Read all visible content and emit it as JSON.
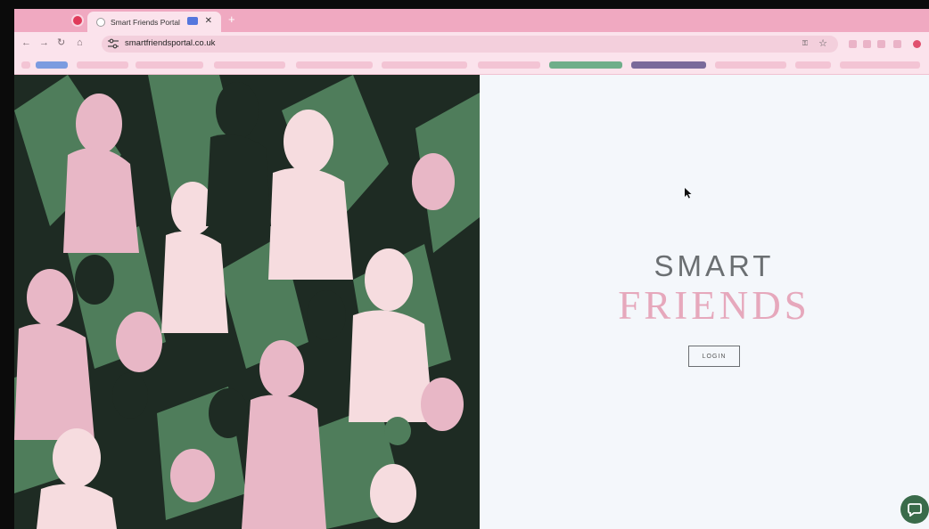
{
  "browser": {
    "tabs": [
      {
        "title": "",
        "active": false
      },
      {
        "title": "Smart Friends Portal",
        "active": true
      }
    ],
    "address": {
      "url": "smartfriendsportal.co.uk"
    },
    "colors": {
      "tabstrip": "#f0a9c1",
      "toolbar": "#fbe3ec",
      "omnibox": "#f3cfdc"
    },
    "icons": [
      "back-icon",
      "forward-icon",
      "reload-icon",
      "home-icon",
      "site-settings-icon",
      "password-key-icon",
      "bookmark-star-icon",
      "recording-icon",
      "close-icon",
      "new-tab-icon"
    ]
  },
  "page": {
    "brand": {
      "line1": "SMART",
      "line2": "FRIENDS"
    },
    "login_label": "LOGIN",
    "colors": {
      "brand_grey": "#6b6f72",
      "brand_pink": "#e6a8bc",
      "art_dark": "#1e2b23",
      "art_green": "#4f7d5b",
      "art_pink": "#e8b7c6",
      "art_light_pink": "#f6dcdf",
      "chat_green": "#3a6b4a"
    }
  }
}
